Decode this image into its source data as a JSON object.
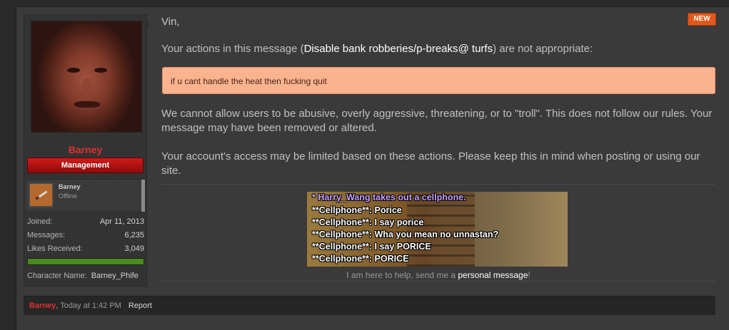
{
  "user": {
    "name": "Barney",
    "role": "Management",
    "mini_name": "Barney",
    "mini_status": "Offline",
    "stats": [
      {
        "label": "Joined:",
        "value": "Apr 11, 2013"
      },
      {
        "label": "Messages:",
        "value": "6,235"
      },
      {
        "label": "Likes Received:",
        "value": "3,049"
      }
    ],
    "character_label": "Character Name:",
    "character_value": "Barney_Phife"
  },
  "message": {
    "greeting": "Vin,",
    "badge": "NEW",
    "p1_before": "Your actions in this message (",
    "p1_highlight": "Disable bank robberies/p-breaks@ turfs",
    "p1_after": ") are not appropriate:",
    "quote": "if u cant handle the heat then fucking quit",
    "p2": "We cannot allow users to be abusive, overly aggressive, threatening, or to \"troll\". This does not follow our rules. Your message may have been removed or altered.",
    "p3": "Your account's access may be limited based on these actions. Please keep this in mind when posting or using our site."
  },
  "signature": {
    "lines": [
      "* Harry_Wang takes out a cellphone.",
      "**Cellphone**: Porice",
      "**Cellphone**: I say porice",
      "**Cellphone**: Wha you mean no unnastan?",
      "**Cellphone**: I say PORICE",
      "**Cellphone**: PORICE"
    ],
    "caption_before": "I am here to help, send me a ",
    "caption_link": "personal message",
    "caption_after": "!"
  },
  "footer": {
    "author": "Barney",
    "date": ", Today at 1:42 PM",
    "report": "Report"
  },
  "colors": {
    "accent_red": "#e03030",
    "badge_orange": "#e2581a",
    "quote_bg": "#f9b38f"
  }
}
